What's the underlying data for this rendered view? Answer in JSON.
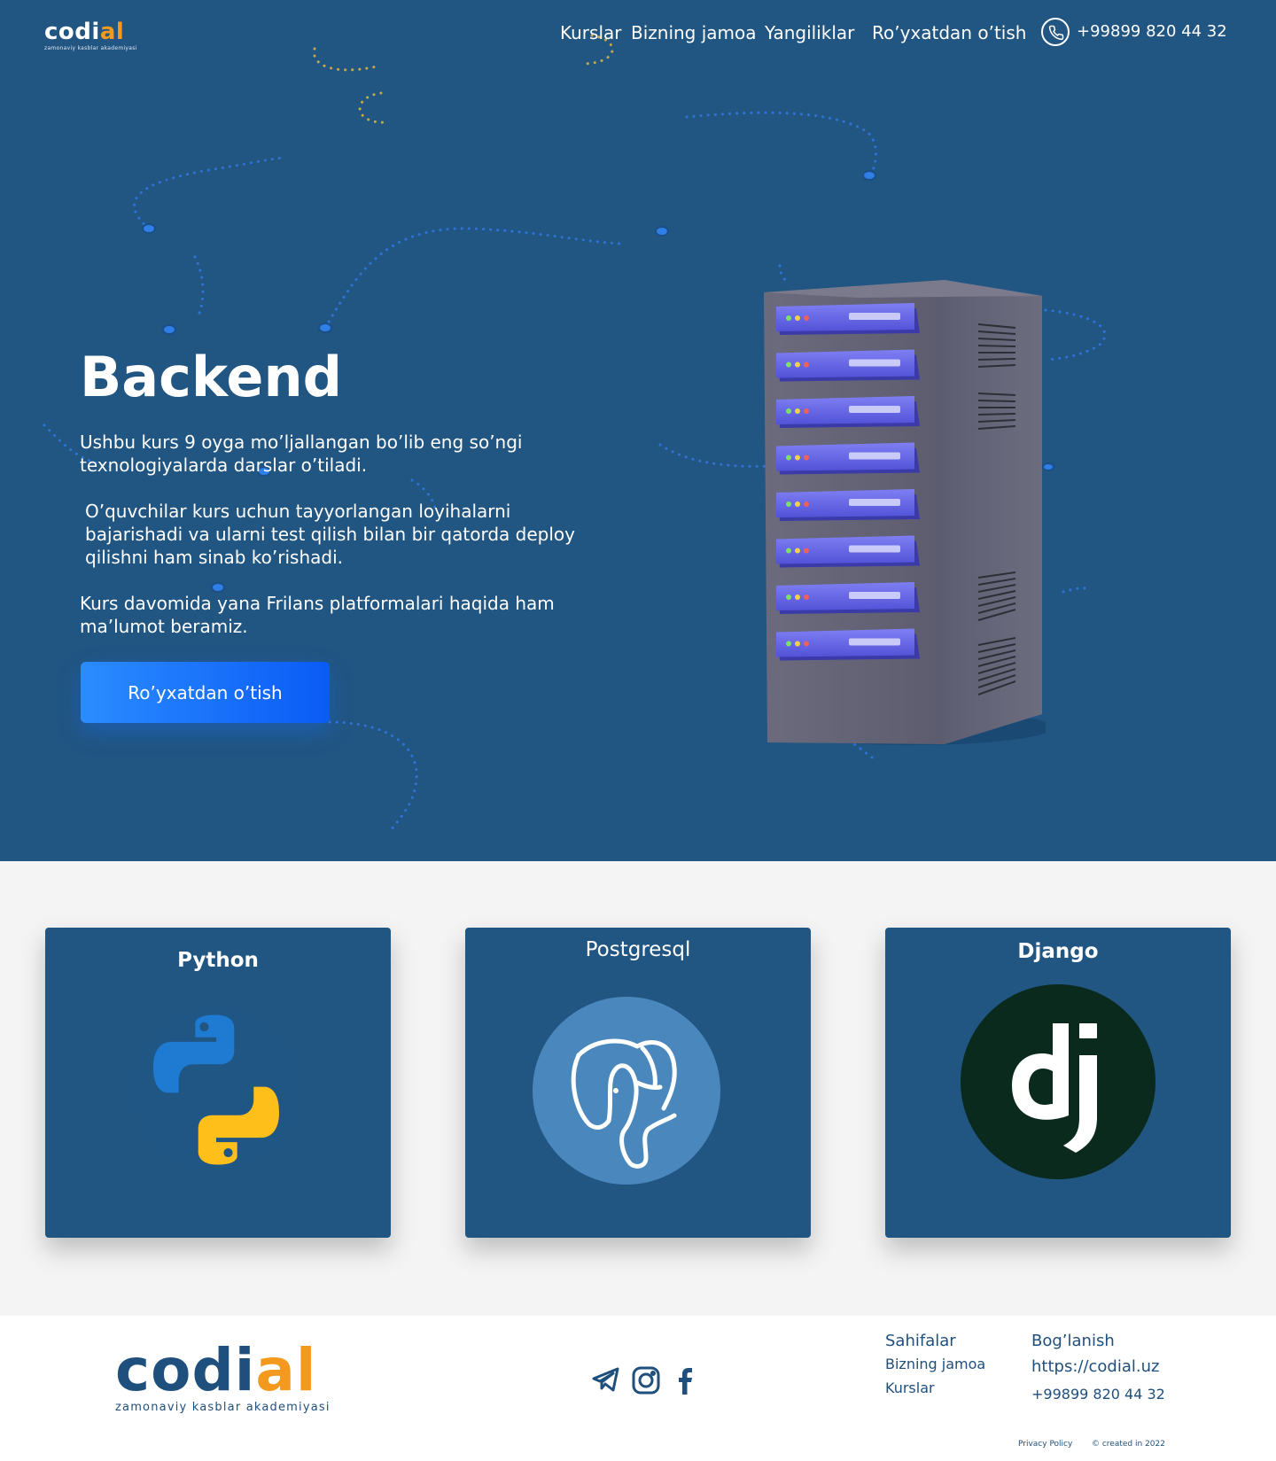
{
  "brand": {
    "name_prefix": "codi",
    "name_accent": "al",
    "tagline": "zamonaviy kasblar akademiyasi",
    "accent_color": "#f39a1e",
    "primary_color": "#215582"
  },
  "nav": {
    "items": [
      {
        "label": "Kurslar"
      },
      {
        "label": "Bizning jamoa"
      },
      {
        "label": "Yangiliklar"
      },
      {
        "label": "Ro’yxatdan o’tish"
      }
    ],
    "phone": "+99899 820 44 32",
    "phone_icon": "phone-icon"
  },
  "hero": {
    "title": "Backend",
    "paragraphs": [
      "Ushbu kurs 9 oyga mo’ljallangan bo’lib eng so’ngi texnologiyalarda darslar o’tiladi.",
      "O’quvchilar kurs uchun tayyorlangan loyihalarni bajarishadi va ularni test qilish bilan bir qatorda deploy qilishni ham sinab ko’rishadi.",
      "Kurs davomida yana Frilans platformalari haqida ham ma’lumot beramiz."
    ],
    "cta_label": "Ro’yxatdan o’tish",
    "illustration": "server-rack"
  },
  "technologies": [
    {
      "title": "Python",
      "icon": "python-logo"
    },
    {
      "title": "Postgresql",
      "icon": "postgresql-logo"
    },
    {
      "title": "Django",
      "icon": "django-logo"
    }
  ],
  "footer": {
    "social_icons": [
      "telegram-icon",
      "instagram-icon",
      "facebook-icon"
    ],
    "pages": {
      "heading": "Sahifalar",
      "links": [
        "Bizning jamoa",
        "Kurslar"
      ]
    },
    "contact": {
      "heading": "Bog’lanish",
      "website": "https://codial.uz",
      "phone": "+99899 820 44 32"
    },
    "privacy": "Privacy Policy",
    "copyright": "© created in 2022"
  }
}
